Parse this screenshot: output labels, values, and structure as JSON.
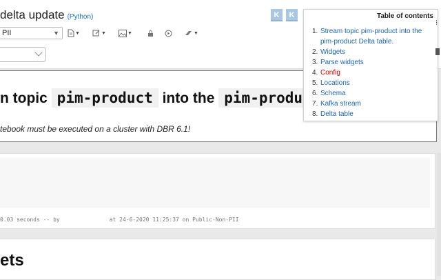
{
  "notebook": {
    "title": "delta update",
    "language": "(Python)"
  },
  "header_buttons": [
    "K",
    "K"
  ],
  "toolbar": {
    "cluster": "PII"
  },
  "cell_heading": {
    "prefix": "n topic",
    "code1": "pim-product",
    "middle": "into the",
    "code2": "pim-product"
  },
  "cell_note": "tebook must be executed on a cluster with DBR 6.1!",
  "run_info": {
    "duration": "0.03 seconds -- by",
    "at": "at 24-6-2020 11:25:37 on Public-Non-PII"
  },
  "next_heading": "ets",
  "toc": {
    "title": "Table of contents",
    "items": [
      {
        "num": "1.",
        "label": "Stream topic pim-product into the pim-product Delta table.",
        "active": false
      },
      {
        "num": "2.",
        "label": "Widgets",
        "active": false
      },
      {
        "num": "3.",
        "label": "Parse widgets",
        "active": false
      },
      {
        "num": "4.",
        "label": "Config",
        "active": true
      },
      {
        "num": "5.",
        "label": "Locations",
        "active": false
      },
      {
        "num": "6.",
        "label": "Schema",
        "active": false
      },
      {
        "num": "7.",
        "label": "Kafka stream",
        "active": false
      },
      {
        "num": "8.",
        "label": "Delta table",
        "active": false
      }
    ]
  },
  "colors": {
    "link": "#1a65b8",
    "active_link": "#d40000",
    "k_button": "#a9c7e3"
  }
}
